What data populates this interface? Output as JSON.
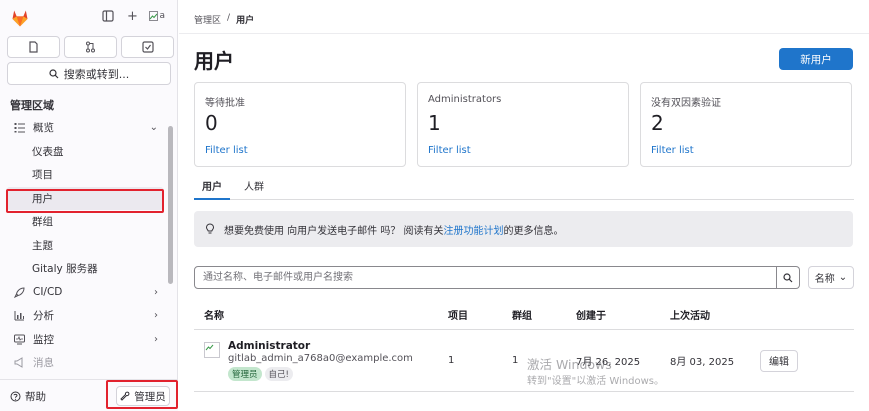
{
  "sidebar": {
    "avatar_alt": "a",
    "search_label": "搜索或转到...",
    "section_title": "管理区域",
    "nav": [
      {
        "label": "概览",
        "icon": "overview-icon",
        "expanded": true
      },
      {
        "label": "仪表盘",
        "sub": true
      },
      {
        "label": "项目",
        "sub": true
      },
      {
        "label": "用户",
        "sub": true,
        "active": true
      },
      {
        "label": "群组",
        "sub": true
      },
      {
        "label": "主题",
        "sub": true
      },
      {
        "label": "Gitaly 服务器",
        "sub": true
      },
      {
        "label": "CI/CD",
        "icon": "rocket-icon"
      },
      {
        "label": "分析",
        "icon": "chart-icon"
      },
      {
        "label": "监控",
        "icon": "monitor-icon"
      },
      {
        "label": "消息",
        "icon": "bullhorn-icon"
      }
    ],
    "help_label": "帮助",
    "admin_label": "管理员"
  },
  "breadcrumb": {
    "root": "管理区",
    "separator": "/",
    "current": "用户"
  },
  "page": {
    "title": "用户",
    "new_user_label": "新用户"
  },
  "cards": [
    {
      "title": "等待批准",
      "value": "0",
      "link": "Filter list"
    },
    {
      "title": "Administrators",
      "value": "1",
      "link": "Filter list"
    },
    {
      "title": "没有双因素验证",
      "value": "2",
      "link": "Filter list"
    }
  ],
  "tabs": {
    "users": "用户",
    "cohorts": "人群"
  },
  "alert": {
    "text_before": "想要免费使用 向用户发送电子邮件 吗？ 阅读有关",
    "link": "注册功能计划",
    "text_after": "的更多信息。"
  },
  "search": {
    "placeholder": "通过名称、电子邮件或用户名搜索",
    "sort_label": "名称"
  },
  "table": {
    "headers": {
      "name": "名称",
      "projects": "项目",
      "groups": "群组",
      "created": "创建于",
      "last_activity": "上次活动"
    },
    "rows": [
      {
        "name": "Administrator",
        "email": "gitlab_admin_a768a0@example.com",
        "badges": [
          "管理员",
          "自己!"
        ],
        "projects": "1",
        "groups": "1",
        "created": "7月 26, 2025",
        "last_activity": "8月 03, 2025",
        "edit_label": "编辑"
      }
    ]
  },
  "watermark": {
    "line1": "激活 Windows",
    "line2": "转到\"设置\"以激活 Windows。"
  },
  "colors": {
    "primary": "#1f75cb",
    "highlight": "#e2222e",
    "badge_green": "#c3e6cd"
  }
}
